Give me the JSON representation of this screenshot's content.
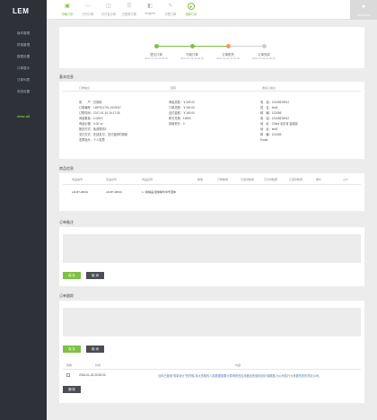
{
  "sidebar": {
    "logo": "LEM",
    "items": [
      {
        "label": "版本管理"
      },
      {
        "label": "终端管理"
      },
      {
        "label": "数据设置"
      },
      {
        "label": "订单展示"
      },
      {
        "label": "订单列表"
      },
      {
        "label": "系统设置"
      }
    ],
    "view_all": "view all"
  },
  "tabs": [
    {
      "label": "待确订单",
      "icon": "cart-icon"
    },
    {
      "label": "已付订单",
      "icon": "card-icon"
    },
    {
      "label": "已打包订单",
      "icon": "box-icon"
    },
    {
      "label": "已配货订单",
      "icon": "list-icon"
    },
    {
      "label": "Shipped",
      "icon": "truck-icon"
    },
    {
      "label": "已签订单",
      "icon": "sign-icon"
    },
    {
      "label": "退款订单",
      "icon": "refund-icon"
    }
  ],
  "user": {
    "label": "XXXXXXX"
  },
  "progress": [
    {
      "label": "提交订单",
      "time": "2016-01-02,23:00:00"
    },
    {
      "label": "付款订单",
      "time": "2016-01-02,23:00:00"
    },
    {
      "label": "订单配货",
      "time": "2016-01-02,23:00:00"
    },
    {
      "label": "订单完成",
      "time": "2016-01-02,23:00:00"
    }
  ],
  "basic": {
    "title": "基本信息",
    "headers": [
      "订单信息",
      "结算",
      "收货人信息"
    ],
    "order_lines": [
      "用　　户：日常用",
      "订单编号：LMPS01791-1000037",
      "订购时间：2017-01-19 16:17:35",
      "商品数量：0.00KG",
      "商品价格：0.00 m³",
      "配送方式：免费物流2",
      "支付方式：在线支付，支付宝即时到帐",
      "发票抬头：个人发票"
    ],
    "settle_lines": [
      "商品总额：￥169.00",
      "订单总额：￥169.00",
      "应付金额：￥169.00",
      "积分兑换：16900",
      "抵用积分：0"
    ],
    "receiver_lines": [
      "电　话：12345678912",
      "姓　名：test1",
      "邮　编：123456",
      "电　话：12345678912",
      "地　址：China 北京省 金鼎区",
      "地　址：test1",
      "邮　编：123455",
      "Email："
    ]
  },
  "goods": {
    "title": "商品信息",
    "headers": [
      "商品编号",
      "货品货号",
      "商品名称",
      "数量",
      "订单数量",
      "已发货数量",
      "已付款数量",
      "已退款数量",
      "单价",
      "小计"
    ],
    "rows": [
      {
        "code": "LM-BT-38001",
        "sku": "LM-BT-38001",
        "name": "1 / 新精品/液体精华中号液体"
      }
    ]
  },
  "notes": {
    "title": "订单备注",
    "save": "保 存",
    "cancel": "取 消"
  },
  "log": {
    "title": "订单跟踪",
    "save": "保 存",
    "cancel": "取 消",
    "headers": [
      "选择",
      "时间",
      "内容"
    ],
    "rows": [
      {
        "time": "2016-01-02,20:00:00",
        "content": "当你已使用“简单设计”的时候,将大多数的人类数据需要计算得来的应用做出的使用设计部数据,为公司执行大多数的的的事业公司。"
      }
    ],
    "delete": "删 除"
  }
}
